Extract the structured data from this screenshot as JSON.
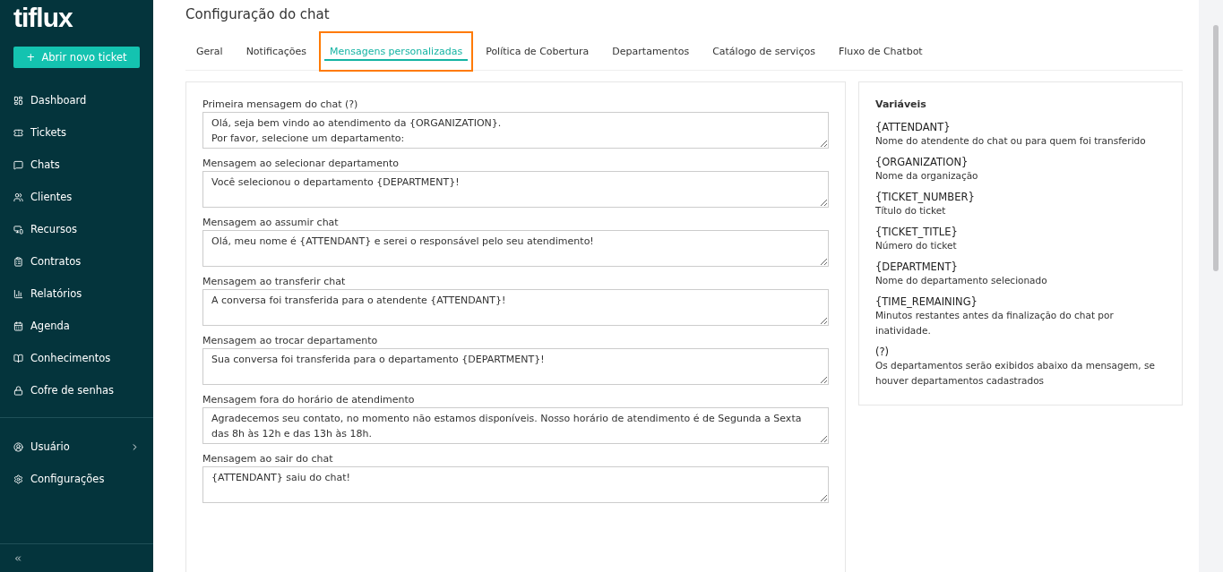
{
  "logo": "tiflux",
  "new_ticket_button": "+  Abrir novo ticket",
  "nav": [
    {
      "label": "Dashboard"
    },
    {
      "label": "Tickets"
    },
    {
      "label": "Chats"
    },
    {
      "label": "Clientes"
    },
    {
      "label": "Recursos"
    },
    {
      "label": "Contratos"
    },
    {
      "label": "Relatórios"
    },
    {
      "label": "Agenda"
    },
    {
      "label": "Conhecimentos"
    },
    {
      "label": "Cofre de senhas"
    }
  ],
  "bottom_nav": [
    {
      "label": "Usuário",
      "has_submenu": true
    },
    {
      "label": "Configurações",
      "has_submenu": false
    }
  ],
  "page_title": "Configuração do chat",
  "tabs": [
    {
      "label": "Geral",
      "selected": false,
      "highlighted": false
    },
    {
      "label": "Notificações",
      "selected": false,
      "highlighted": false
    },
    {
      "label": "Mensagens personalizadas",
      "selected": true,
      "highlighted": true
    },
    {
      "label": "Política de Cobertura",
      "selected": false,
      "highlighted": false
    },
    {
      "label": "Departamentos",
      "selected": false,
      "highlighted": false
    },
    {
      "label": "Catálogo de serviços",
      "selected": false,
      "highlighted": false
    },
    {
      "label": "Fluxo de Chatbot",
      "selected": false,
      "highlighted": false
    }
  ],
  "messages": [
    {
      "label": "Primeira mensagem do chat (?)",
      "value": "Olá, seja bem vindo ao atendimento da {ORGANIZATION}.\nPor favor, selecione um departamento:"
    },
    {
      "label": "Mensagem ao selecionar departamento",
      "value": "Você selecionou o departamento {DEPARTMENT}!"
    },
    {
      "label": "Mensagem ao assumir chat",
      "value": "Olá, meu nome é {ATTENDANT} e serei o responsável pelo seu atendimento!"
    },
    {
      "label": "Mensagem ao transferir chat",
      "value": "A conversa foi transferida para o atendente {ATTENDANT}!"
    },
    {
      "label": "Mensagem ao trocar departamento",
      "value": "Sua conversa foi transferida para o departamento {DEPARTMENT}!"
    },
    {
      "label": "Mensagem fora do horário de atendimento",
      "value": "Agradecemos seu contato, no momento não estamos disponíveis. Nosso horário de atendimento é de Segunda a Sexta das 8h às 12h e das 13h às 18h."
    },
    {
      "label": "Mensagem ao sair do chat",
      "value": "{ATTENDANT} saiu do chat!"
    }
  ],
  "variables": {
    "title": "Variáveis",
    "items": [
      {
        "name": "{ATTENDANT}",
        "description": "Nome do atendente do chat ou para quem foi transferido"
      },
      {
        "name": "{ORGANIZATION}",
        "description": "Nome da organização"
      },
      {
        "name": "{TICKET_NUMBER}",
        "description": "Título do ticket"
      },
      {
        "name": "{TICKET_TITLE}",
        "description": "Número do ticket"
      },
      {
        "name": "{DEPARTMENT}",
        "description": "Nome do departamento selecionado"
      },
      {
        "name": "{TIME_REMAINING}",
        "description": "Minutos restantes antes da finalização do chat por inatividade."
      },
      {
        "name": "(?)",
        "description": "Os departamentos serão exibidos abaixo da mensagem, se houver departamentos cadastrados"
      }
    ]
  }
}
